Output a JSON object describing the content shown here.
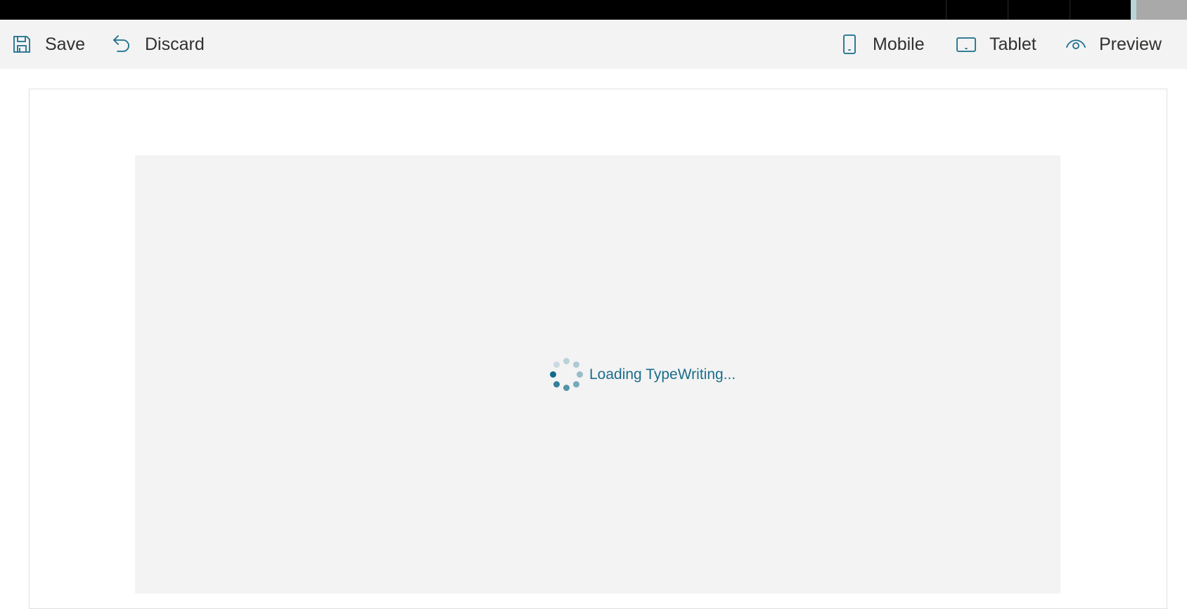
{
  "toolbar": {
    "save_label": "Save",
    "discard_label": "Discard",
    "mobile_label": "Mobile",
    "tablet_label": "Tablet",
    "preview_label": "Preview"
  },
  "icons": {
    "save": "save-icon",
    "discard": "undo-icon",
    "mobile": "mobile-phone-icon",
    "tablet": "tablet-icon",
    "preview": "eye-icon"
  },
  "loading": {
    "text": "Loading TypeWriting..."
  },
  "colors": {
    "accent": "#0f6b8a",
    "toolbar_bg": "#f3f3f3",
    "content_bg": "#f3f3f3",
    "top_strip": "#000000"
  }
}
